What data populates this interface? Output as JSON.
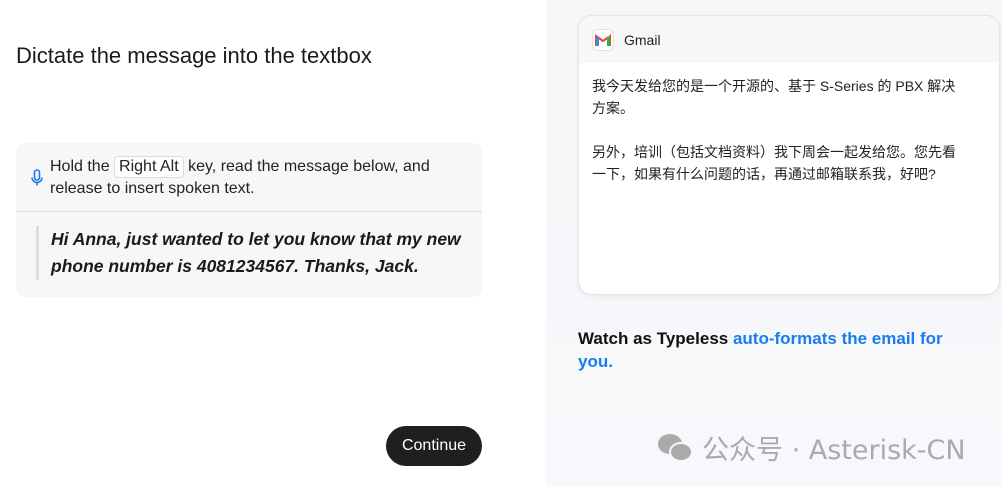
{
  "left": {
    "title": "Dictate the message into the textbox",
    "instruction_before": "Hold the",
    "key": "Right Alt",
    "instruction_after": "key, read the message below, and release to insert spoken text.",
    "message": "Hi Anna, just wanted to let you know that my new phone number is 4081234567. Thanks, Jack.",
    "continue_label": "Continue"
  },
  "right": {
    "app_name": "Gmail",
    "paragraphs": [
      "我今天发给您的是一个开源的、基于 S-Series 的 PBX 解决方案。",
      "另外，培训（包括文档资料）我下周会一起发给您。您先看一下，如果有什么问题的话，再通过邮箱联系我，好吧?"
    ],
    "caption_plain": "Watch as Typeless ",
    "caption_highlight": "auto-formats the email for you.",
    "accent": "#1a7cf0"
  },
  "watermark": "公众号 · Asterisk-CN"
}
